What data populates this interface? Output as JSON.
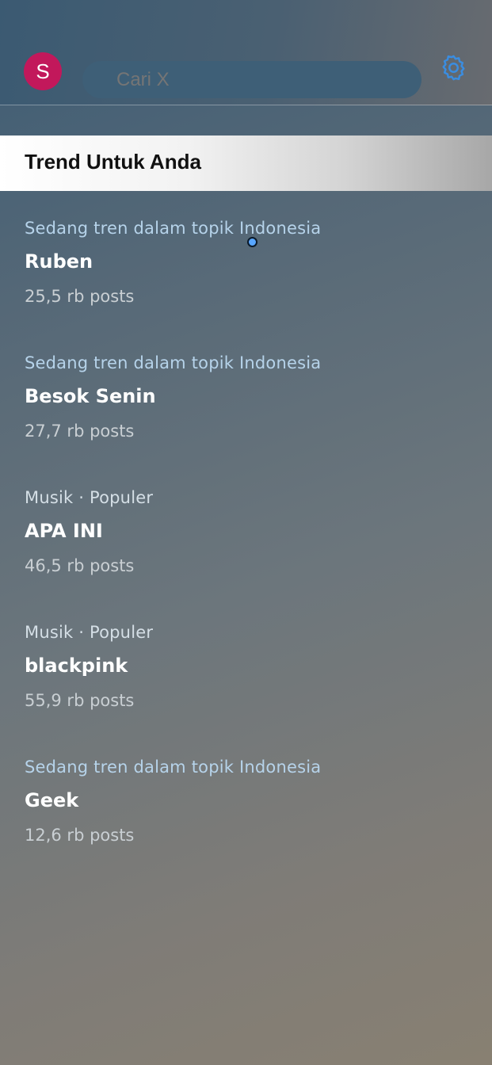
{
  "header": {
    "avatar_initial": "S",
    "search_placeholder": "Cari X",
    "settings_icon": "gear-icon"
  },
  "section": {
    "title": "Trend Untuk Anda"
  },
  "trends": [
    {
      "context": "Sedang tren dalam topik Indonesia",
      "name": "Ruben",
      "count": "25,5 rb posts"
    },
    {
      "context": "Sedang tren dalam topik Indonesia",
      "name": "Besok Senin",
      "count": "27,7 rb posts"
    },
    {
      "context": "Musik · Populer",
      "name": "APA INI",
      "count": "46,5 rb posts"
    },
    {
      "context": "Musik · Populer",
      "name": "blackpink",
      "count": "55,9 rb posts"
    },
    {
      "context": "Sedang tren dalam topik Indonesia",
      "name": "Geek",
      "count": "12,6 rb posts"
    }
  ],
  "colors": {
    "accent": "#3a8de0",
    "avatar_bg": "#c2185b"
  }
}
